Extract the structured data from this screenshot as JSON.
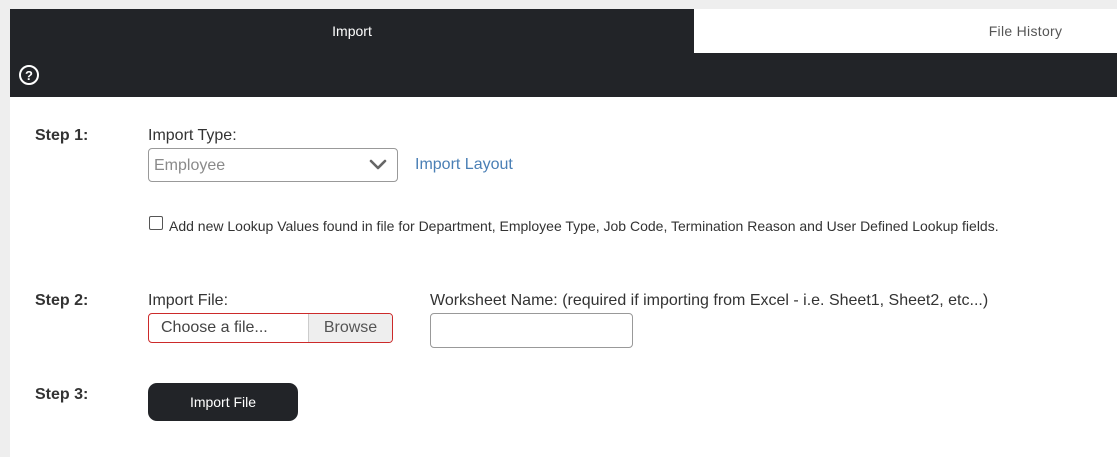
{
  "tabs": [
    {
      "label": "Import",
      "active": true
    },
    {
      "label": "File History",
      "active": false
    }
  ],
  "toolbar": {
    "help_icon": "?"
  },
  "step1": {
    "label": "Step 1:",
    "import_type_label": "Import Type:",
    "import_type_value": "Employee",
    "import_layout_link": "Import Layout",
    "checkbox_checked": false,
    "checkbox_label": "Add new Lookup Values found in file for Department, Employee Type, Job Code, Termination Reason and User Defined Lookup fields."
  },
  "step2": {
    "label": "Step 2:",
    "import_file_label": "Import File:",
    "file_placeholder": "Choose a file...",
    "browse_label": "Browse",
    "worksheet_label": "Worksheet Name: (required if importing from Excel - i.e. Sheet1, Sheet2, etc...)",
    "worksheet_value": ""
  },
  "step3": {
    "label": "Step 3:",
    "import_button": "Import File"
  },
  "colors": {
    "dark": "#222428",
    "link": "#4a7fb5",
    "error_border": "#cc2a2a"
  }
}
